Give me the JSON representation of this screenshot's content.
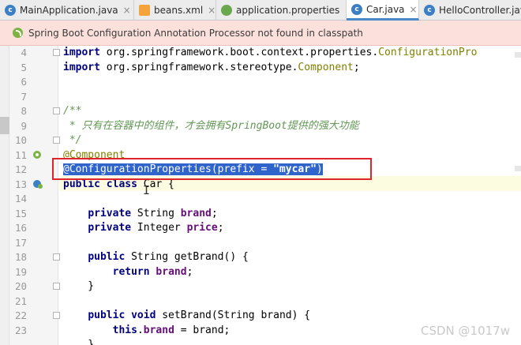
{
  "tabs": [
    {
      "label": "MainApplication.java",
      "icon": "class-icon",
      "active": false
    },
    {
      "label": "beans.xml",
      "icon": "xml-file-icon",
      "active": false
    },
    {
      "label": "application.properties",
      "icon": "properties-file-icon",
      "active": false
    },
    {
      "label": "Car.java",
      "icon": "class-icon",
      "active": true
    },
    {
      "label": "HelloController.java",
      "icon": "class-icon",
      "active": false
    }
  ],
  "tab_close_glyph": "×",
  "banner": {
    "text": "Spring Boot Configuration Annotation Processor not found in classpath"
  },
  "editor": {
    "line_numbers": [
      "4",
      "5",
      "6",
      "7",
      "8",
      "9",
      "10",
      "11",
      "12",
      "13",
      "14",
      "15",
      "16",
      "17",
      "18",
      "19",
      "20",
      "21",
      "22",
      "23"
    ],
    "lines": [
      [
        "import",
        " org.springframework.boot.context.properties.",
        "ConfigurationPro"
      ],
      [
        "import",
        " org.springframework.stereotype.",
        "Component",
        ";"
      ],
      [],
      [],
      [
        "/**"
      ],
      [
        " * 只有在容器中的组件，才会拥有SpringBoot提供的强大功能"
      ],
      [
        " */"
      ],
      [
        "@Component"
      ],
      [
        "@ConfigurationProperties(prefix = ",
        "\"mycar\"",
        ")"
      ],
      [
        "public class",
        " Car {"
      ],
      [],
      [
        "    ",
        "private",
        " String ",
        "brand",
        ";"
      ],
      [
        "    ",
        "private",
        " Integer ",
        "price",
        ";"
      ],
      [],
      [
        "    ",
        "public",
        " String getBrand() {"
      ],
      [
        "        ",
        "return",
        " ",
        "brand",
        ";"
      ],
      [
        "    }"
      ],
      [],
      [
        "    ",
        "public void",
        " setBrand(String brand) {"
      ],
      [
        "        ",
        "this",
        ".",
        "brand",
        " = brand;"
      ]
    ],
    "last_line_partial": "    }"
  },
  "colors": {
    "selection": "#2f65ca",
    "highlight_box": "#e0242b",
    "banner_bg": "#fbe0db"
  },
  "watermark": "CSDN @1017w"
}
